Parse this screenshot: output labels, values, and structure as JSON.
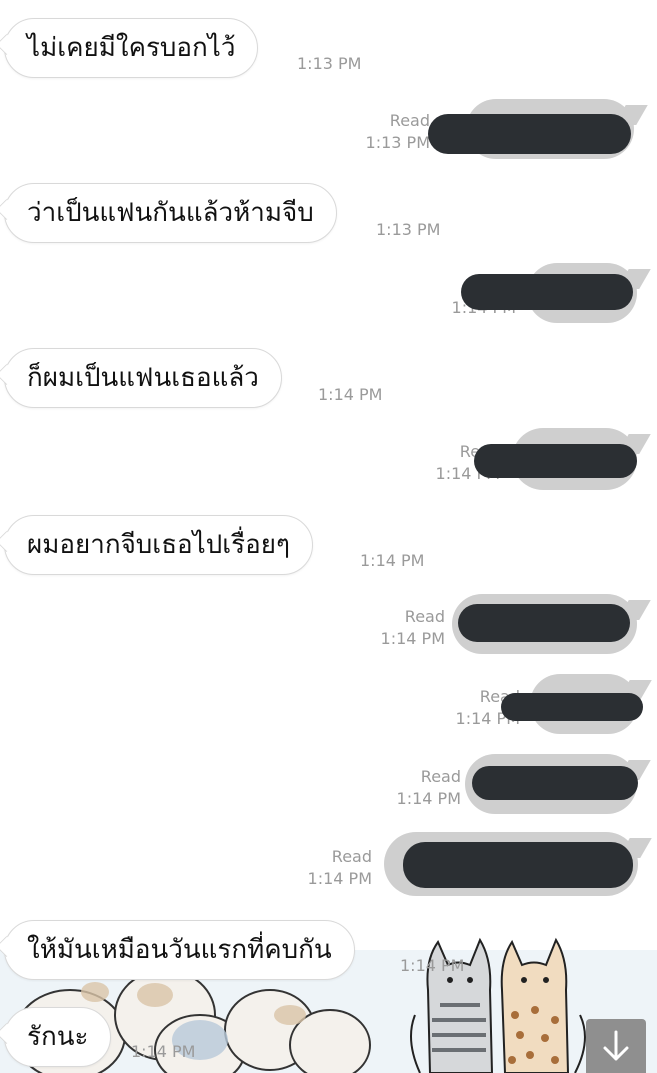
{
  "incoming": [
    {
      "text": "ไม่เคยมีใครบอกไว้",
      "time": "1:13 PM"
    },
    {
      "text": "ว่าเป็นแฟนกันแล้วห้ามจีบ",
      "time": "1:13 PM"
    },
    {
      "text": "ก็ผมเป็นแฟนเธอแล้ว",
      "time": "1:14 PM"
    },
    {
      "text": "ผมอยากจีบเธอไปเรื่อยๆ",
      "time": "1:14 PM"
    },
    {
      "text": "ให้มันเหมือนวันแรกที่คบกัน",
      "time": "1:14 PM"
    },
    {
      "text": "รักนะ",
      "time": "1:14 PM"
    }
  ],
  "outgoing": [
    {
      "read": "Read",
      "time": "1:13 PM"
    },
    {
      "read": "",
      "time": "1:14 PM"
    },
    {
      "read": "Read",
      "time": "1:14 PM"
    },
    {
      "read": "Read",
      "time": "1:14 PM"
    },
    {
      "read": "Read",
      "time": "1:14 PM"
    },
    {
      "read": "Read",
      "time": "1:14 PM"
    },
    {
      "read": "Read",
      "time": "1:14 PM"
    }
  ],
  "scroll_button": {
    "icon": "arrow-down-icon"
  },
  "colors": {
    "outgoing_bubble": "#cfcfcf",
    "redaction": "#2b2f33",
    "scroll_button": "#8f8f8f"
  }
}
